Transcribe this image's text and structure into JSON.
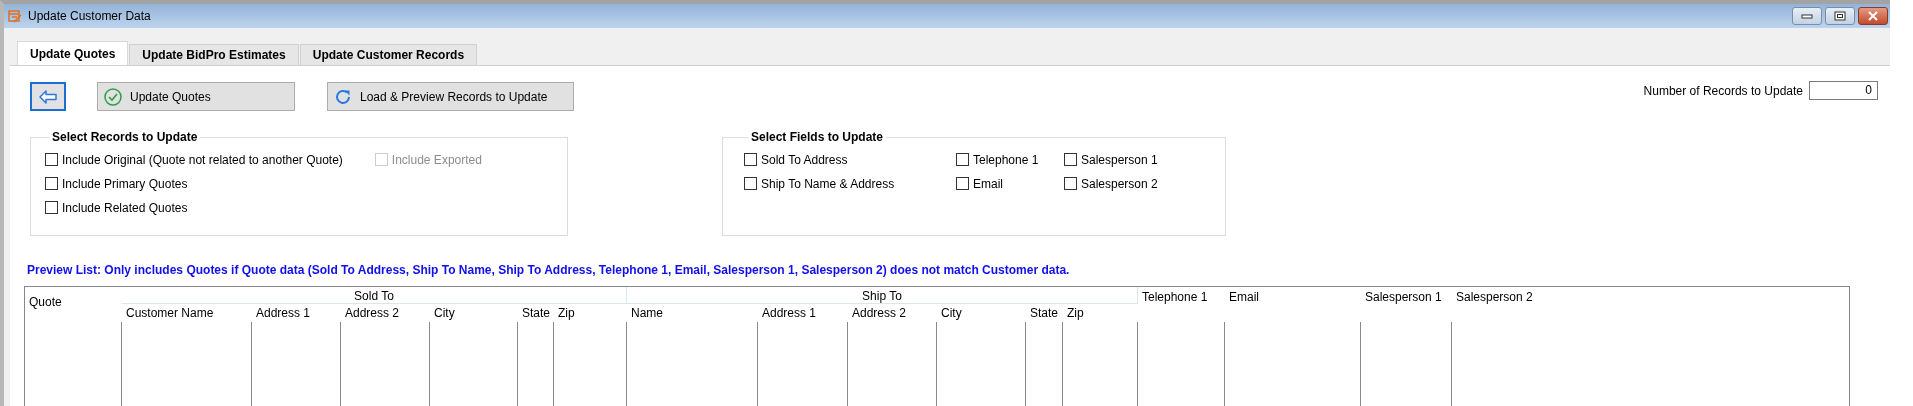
{
  "window": {
    "title": "Update Customer Data"
  },
  "tabs": [
    {
      "label": "Update Quotes",
      "selected": true
    },
    {
      "label": "Update BidPro Estimates",
      "selected": false
    },
    {
      "label": "Update Customer Records",
      "selected": false
    }
  ],
  "toolbar": {
    "buttons": [
      {
        "kind": "back"
      },
      {
        "kind": "update",
        "label": "Update Quotes"
      },
      {
        "kind": "refresh",
        "label": "Load & Preview Records to Update"
      }
    ],
    "record_count": {
      "label": "Number of Records to Update",
      "value": "0"
    }
  },
  "records_group": {
    "title": "Select Records to Update",
    "columns": [
      [
        {
          "label": "Include Original (Quote not related to another Quote)",
          "checked": false,
          "disabled": false
        },
        {
          "label": "Include Primary Quotes",
          "checked": false,
          "disabled": false
        },
        {
          "label": "Include Related Quotes",
          "checked": false,
          "disabled": false
        }
      ],
      [
        {
          "label": "Include Exported",
          "checked": false,
          "disabled": true
        }
      ]
    ]
  },
  "fields_group": {
    "title": "Select Fields to Update",
    "columns": [
      [
        {
          "label": "Sold To Address",
          "checked": false,
          "disabled": false
        },
        {
          "label": "Ship To Name & Address",
          "checked": false,
          "disabled": false
        }
      ],
      [
        {
          "label": "Telephone 1",
          "checked": false,
          "disabled": false
        },
        {
          "label": "Email",
          "checked": false,
          "disabled": false
        }
      ],
      [
        {
          "label": "Salesperson 1",
          "checked": false,
          "disabled": false
        },
        {
          "label": "Salesperson 2",
          "checked": false,
          "disabled": false
        }
      ]
    ]
  },
  "preview_note": "Preview List:  Only includes Quotes if Quote data (Sold To Address, Ship To Name, Ship To Address, Telephone 1, Email, Salesperson 1, Salesperson 2) does not match Customer data.",
  "table": {
    "columns": [
      {
        "label": "Quote"
      },
      {
        "label": "Sold To",
        "children": [
          {
            "label": "Customer Name"
          },
          {
            "label": "Address 1"
          },
          {
            "label": "Address 2"
          },
          {
            "label": "City"
          },
          {
            "label": "State"
          },
          {
            "label": "Zip"
          }
        ]
      },
      {
        "label": "Ship To",
        "children": [
          {
            "label": "Name"
          },
          {
            "label": "Address 1"
          },
          {
            "label": "Address 2"
          },
          {
            "label": "City"
          },
          {
            "label": "State"
          },
          {
            "label": "Zip"
          }
        ]
      },
      {
        "label": "Telephone 1"
      },
      {
        "label": "Email"
      },
      {
        "label": "Salesperson 1"
      },
      {
        "label": "Salesperson 2"
      }
    ]
  }
}
